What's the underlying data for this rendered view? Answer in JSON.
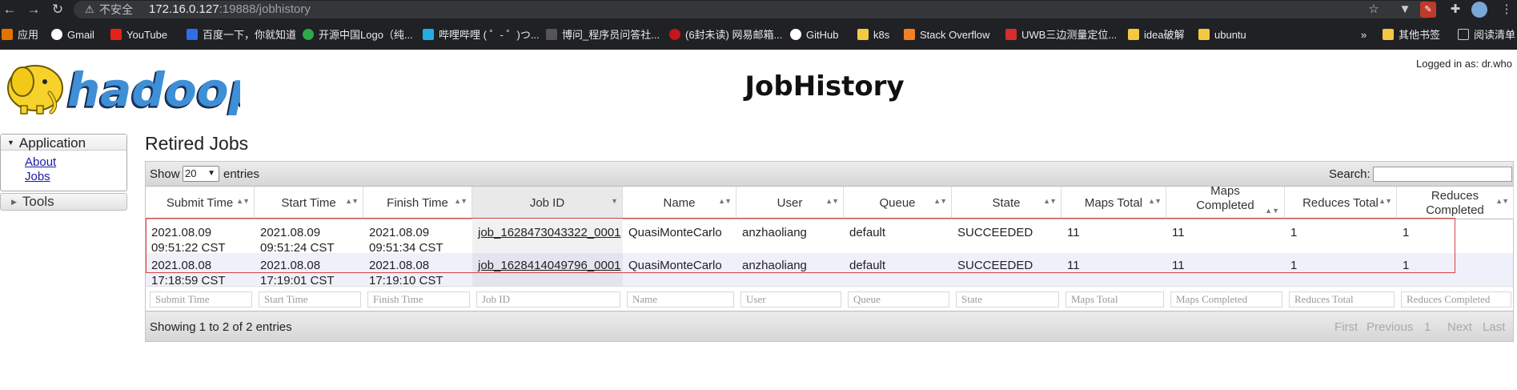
{
  "browser": {
    "security_label": "不安全",
    "url_host": "172.16.0.127",
    "url_rest": ":19888/jobhistory",
    "bookmarks": [
      "应用",
      "Gmail",
      "YouTube",
      "百度一下，你就知道",
      "开源中国Logo（纯...",
      "哔哩哔哩 ( ゜- ゜)つ...",
      "博问_程序员问答社...",
      "(6封未读) 网易邮箱...",
      "GitHub",
      "k8s",
      "Stack Overflow",
      "UWB三边测量定位...",
      "idea破解",
      "ubuntu",
      "»",
      "其他书签",
      "阅读清单"
    ]
  },
  "header": {
    "logo_text": "hadoop",
    "title": "JobHistory",
    "logged_in": "Logged in as: dr.who"
  },
  "sidebar": {
    "application_label": "Application",
    "links": [
      "About",
      "Jobs"
    ],
    "tools_label": "Tools"
  },
  "main": {
    "section_title": "Retired Jobs",
    "show_label": "Show",
    "page_length": "20",
    "entries_label": "entries",
    "search_label": "Search:",
    "columns": [
      "Submit Time",
      "Start Time",
      "Finish Time",
      "Job ID",
      "Name",
      "User",
      "Queue",
      "State",
      "Maps Total",
      "Maps Completed",
      "Reduces Total",
      "Reduces Completed"
    ],
    "rows": [
      {
        "submit_1": "2021.08.09",
        "submit_2": "09:51:22 CST",
        "start_1": "2021.08.09",
        "start_2": "09:51:24 CST",
        "finish_1": "2021.08.09",
        "finish_2": "09:51:34 CST",
        "job_id": "job_1628473043322_0001",
        "name": "QuasiMonteCarlo",
        "user": "anzhaoliang",
        "queue": "default",
        "state": "SUCCEEDED",
        "maps_total": "11",
        "maps_completed": "11",
        "reduces_total": "1",
        "reduces_completed": "1"
      },
      {
        "submit_1": "2021.08.08",
        "submit_2": "17:18:59 CST",
        "start_1": "2021.08.08",
        "start_2": "17:19:01 CST",
        "finish_1": "2021.08.08",
        "finish_2": "17:19:10 CST",
        "job_id": "job_1628414049796_0001",
        "name": "QuasiMonteCarlo",
        "user": "anzhaoliang",
        "queue": "default",
        "state": "SUCCEEDED",
        "maps_total": "11",
        "maps_completed": "11",
        "reduces_total": "1",
        "reduces_completed": "1"
      }
    ],
    "filters": [
      "Submit Time",
      "Start Time",
      "Finish Time",
      "Job ID",
      "Name",
      "User",
      "Queue",
      "State",
      "Maps Total",
      "Maps Completed",
      "Reduces Total",
      "Reduces Completed"
    ],
    "info": "Showing 1 to 2 of 2 entries",
    "pagination": [
      "First",
      "Previous",
      "1",
      "Next",
      "Last"
    ]
  }
}
